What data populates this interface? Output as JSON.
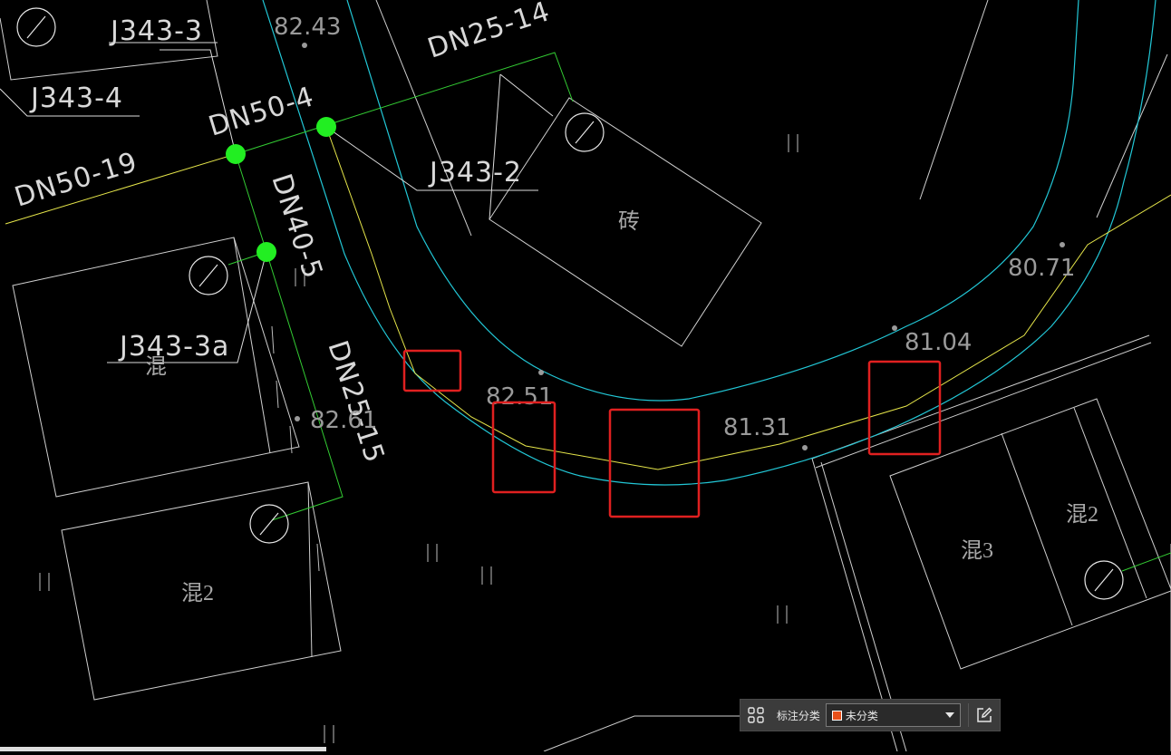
{
  "drawing": {
    "pipe_labels": [
      "J343-3",
      "J343-4",
      "DN50-4",
      "DN25-14",
      "J343-2",
      "DN50-19",
      "DN40-5",
      "J343-3a",
      "DN25-15"
    ],
    "elevations": [
      "82.43",
      "80.71",
      "81.04",
      "82.51",
      "81.31",
      "82.61"
    ],
    "materials": [
      "砖",
      "混",
      "混2",
      "混3",
      "混2"
    ]
  },
  "toolbar": {
    "category_label": "标注分类",
    "category_value": "未分类",
    "swatch_color": "#e8501a"
  },
  "colors": {
    "background": "#000000",
    "building_line": "#d0d0d0",
    "road_cyan": "#22c7d6",
    "pipe_yellow": "#e6e64a",
    "pipe_green": "#33cc33",
    "node_green": "#22ee22",
    "markup_red": "#e02020"
  },
  "icons": {
    "grid": "grid-icon",
    "edit": "edit-icon",
    "caret": "chevron-down-icon"
  }
}
